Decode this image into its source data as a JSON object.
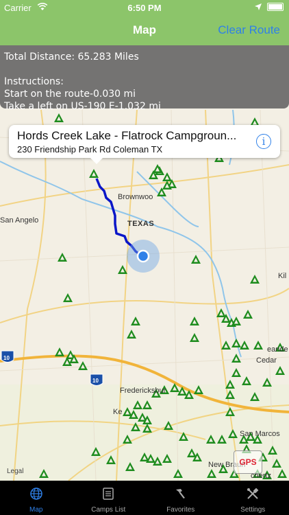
{
  "status_bar": {
    "carrier": "Carrier",
    "time": "6:50 PM"
  },
  "nav": {
    "title": "Map",
    "clear_route": "Clear Route"
  },
  "route_info": {
    "total_distance": "Total Distance: 65.283 Miles",
    "instructions_label": "Instructions:",
    "steps": [
      "Start on the route-0.030 mi",
      "Take a left on US-190 E-1.032 mi"
    ]
  },
  "callout": {
    "name": "Hords Creek Lake - Flatrock Campgroun...",
    "address": "230 Friendship Park Rd Coleman TX"
  },
  "map_labels": {
    "brownwood": "Brownwoo",
    "texas": "TEXAS",
    "san_angelo": "San Angelo",
    "kil": "Kil",
    "leander": "eande",
    "cedar": "Cedar",
    "fredericksburg": "Fredericksbur",
    "ke": "Ke",
    "san_marcos": "San Marcos",
    "new_braunfels": "New Braun",
    "schertz": "chertz",
    "i10_a": "10",
    "i10_b": "10",
    "legal": "Legal"
  },
  "gps_button": "GPS",
  "tabs": [
    {
      "label": "Map",
      "icon": "globe-icon"
    },
    {
      "label": "Camps List",
      "icon": "list-icon"
    },
    {
      "label": "Favorites",
      "icon": "hammer-icon"
    },
    {
      "label": "Settings",
      "icon": "tools-icon"
    }
  ],
  "colors": {
    "nav": "#8cc56a",
    "accent": "#2f80e8",
    "route": "#0a16c8",
    "camp": "#1e8c1e"
  }
}
